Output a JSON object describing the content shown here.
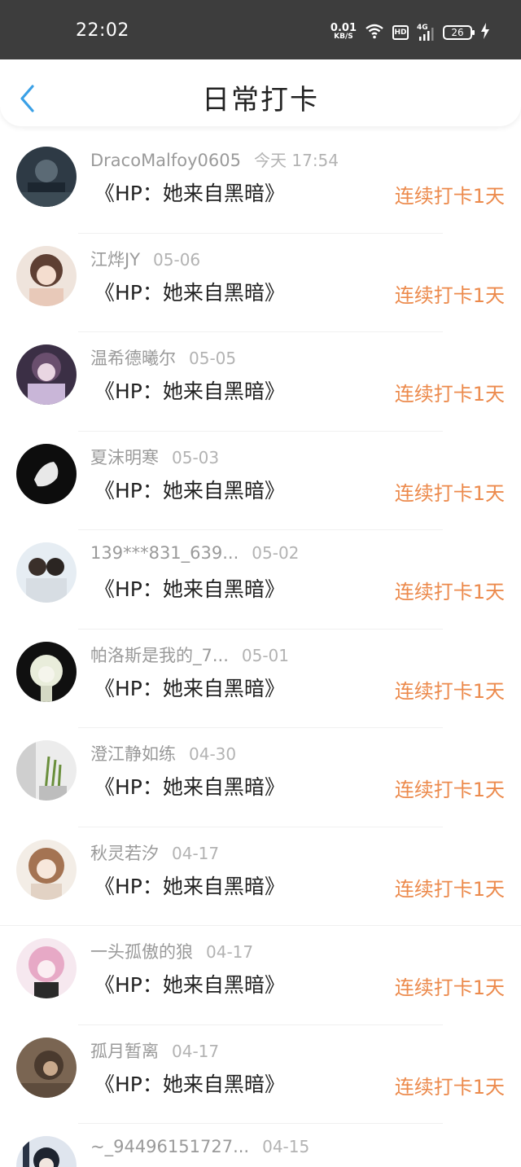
{
  "status_bar": {
    "time": "22:02",
    "net_speed_value": "0.01",
    "net_speed_unit": "KB/S",
    "hd_label": "HD",
    "network_label": "4G",
    "battery_level": "26"
  },
  "header": {
    "title": "日常打卡"
  },
  "colors": {
    "accent_orange": "#ec8a4c",
    "back_arrow": "#3aa0e6",
    "status_bar_bg": "#3d3d3d"
  },
  "feed": [
    {
      "name": "DracoMalfoy0605",
      "date": "今天 17:54",
      "book": "《HP：她来自黑暗》",
      "streak": "连续打卡1天"
    },
    {
      "name": "江烨JY",
      "date": "05-06",
      "book": "《HP：她来自黑暗》",
      "streak": "连续打卡1天"
    },
    {
      "name": "温希德曦尔",
      "date": "05-05",
      "book": "《HP：她来自黑暗》",
      "streak": "连续打卡1天"
    },
    {
      "name": "夏沫明寒",
      "date": "05-03",
      "book": "《HP：她来自黑暗》",
      "streak": "连续打卡1天"
    },
    {
      "name": "139***831_639...",
      "date": "05-02",
      "book": "《HP：她来自黑暗》",
      "streak": "连续打卡1天"
    },
    {
      "name": "帕洛斯是我的_7...",
      "date": "05-01",
      "book": "《HP：她来自黑暗》",
      "streak": "连续打卡1天"
    },
    {
      "name": "澄江静如练",
      "date": "04-30",
      "book": "《HP：她来自黑暗》",
      "streak": "连续打卡1天"
    },
    {
      "name": "秋灵若汐",
      "date": "04-17",
      "book": "《HP：她来自黑暗》",
      "streak": "连续打卡1天"
    },
    {
      "name": "一头孤傲的狼",
      "date": "04-17",
      "book": "《HP：她来自黑暗》",
      "streak": "连续打卡1天"
    },
    {
      "name": "孤月暂离",
      "date": "04-17",
      "book": "《HP：她来自黑暗》",
      "streak": "连续打卡1天"
    },
    {
      "name": "~_94496151727...",
      "date": "04-15",
      "book": "",
      "streak": ""
    }
  ]
}
